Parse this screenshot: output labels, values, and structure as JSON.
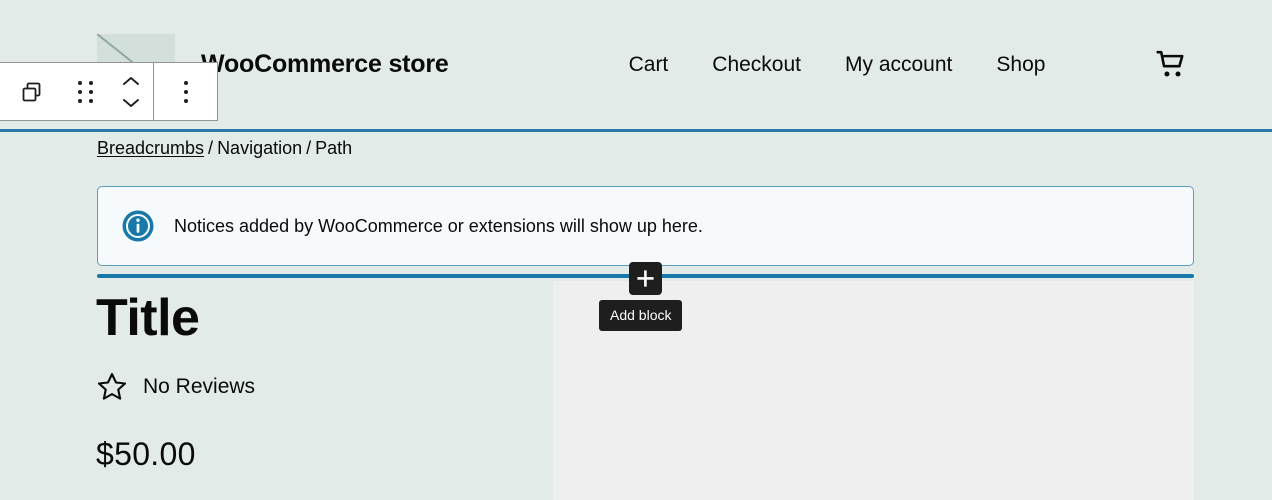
{
  "header": {
    "logo_alt": "site-logo-placeholder",
    "site_title": "WooCommerce store",
    "nav": [
      {
        "label": "Cart"
      },
      {
        "label": "Checkout"
      },
      {
        "label": "My account"
      },
      {
        "label": "Shop"
      }
    ],
    "cart_icon": "shopping-cart-icon",
    "border_color": "#2b7aaa"
  },
  "breadcrumbs": {
    "link_label": "Breadcrumbs",
    "separator": "/",
    "segment_two": "Navigation",
    "segment_three": "Path"
  },
  "notice": {
    "icon": "info-circle-icon",
    "text": "Notices added by WooCommerce or extensions will show up here.",
    "border_color": "#5d9ec0",
    "icon_color": "#1878a8",
    "background": "#f6fafd"
  },
  "inserter": {
    "plus_label": "+",
    "tooltip": "Add block",
    "insertion_line_color": "#1878a8"
  },
  "product": {
    "title": "Title",
    "rating_icon": "star-outline-icon",
    "rating_text": "No Reviews",
    "price": "$50.00"
  },
  "block_toolbar": {
    "block_type_icon": "copy-blocks-icon",
    "drag_handle_icon": "drag-handle-dots-icon",
    "move_up_icon": "chevron-up-icon",
    "move_down_icon": "chevron-down-icon",
    "options_icon": "more-vertical-dots-icon"
  }
}
